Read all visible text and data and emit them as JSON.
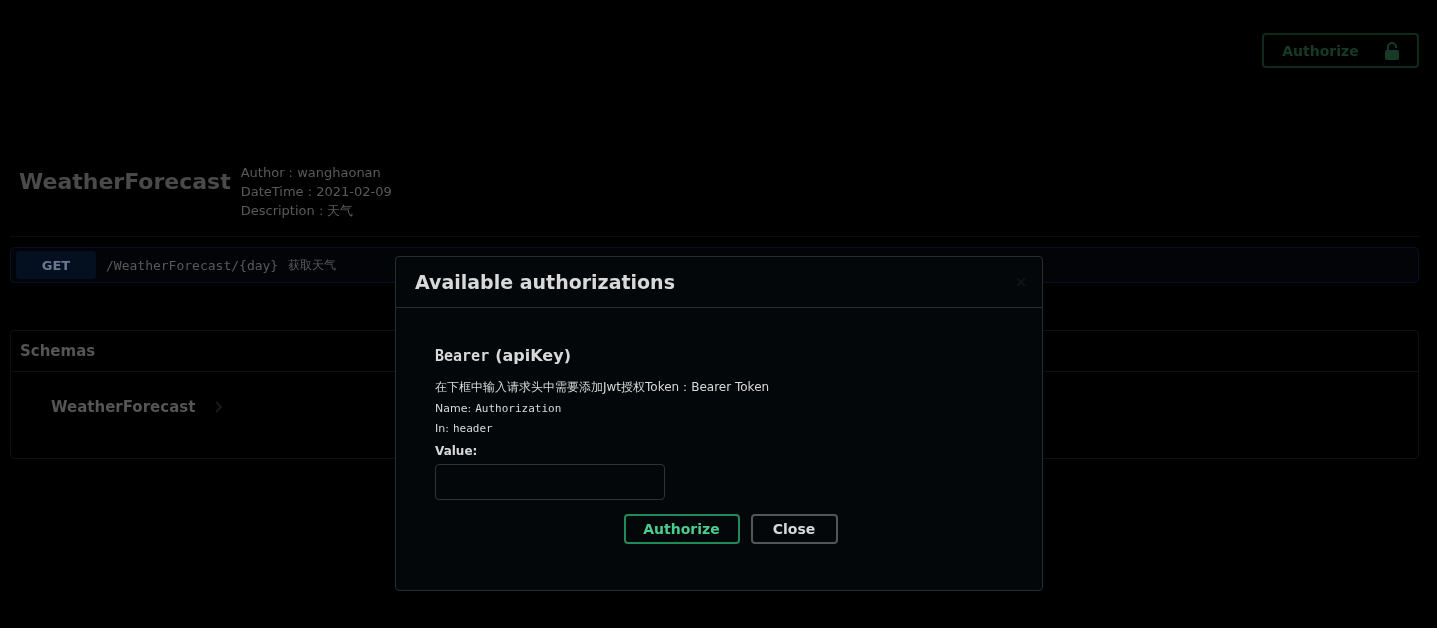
{
  "top_bar": {
    "authorize_button": "Authorize"
  },
  "info": {
    "title": "WeatherForecast",
    "meta": [
      "Author : wanghaonan",
      "DateTime : 2021-02-09",
      "Description : 天气"
    ]
  },
  "operations": [
    {
      "method": "GET",
      "path": "/WeatherForecast/{day}",
      "summary": "获取天气"
    }
  ],
  "schemas": {
    "title": "Schemas",
    "items": [
      {
        "name": "WeatherForecast",
        "expanded": false
      }
    ]
  },
  "modal": {
    "title": "Available authorizations",
    "scheme": {
      "name": "Bearer",
      "type": "(apiKey)"
    },
    "description": "在下框中输入请求头中需要添加Jwt授权Token：Bearer Token",
    "fields": [
      {
        "label": "Name:",
        "value": "Authorization"
      },
      {
        "label": "In:",
        "value": "header"
      }
    ],
    "value_label": "Value:",
    "buttons": [
      {
        "label": "Authorize",
        "kind": "primary"
      },
      {
        "label": "Close",
        "kind": "secondary"
      }
    ]
  }
}
